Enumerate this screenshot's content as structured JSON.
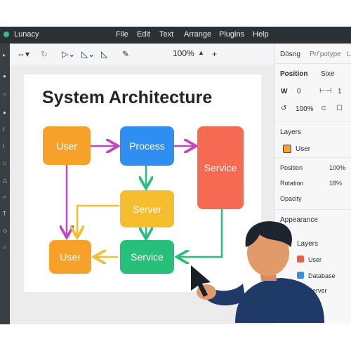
{
  "app": {
    "name": "Lunacy"
  },
  "menu": [
    "File",
    "Edit",
    "Text",
    "Arrange",
    "Plugins",
    "Help"
  ],
  "toolbar": {
    "zoom": "100%"
  },
  "canvas": {
    "title": "System Architecture",
    "nodes": {
      "user_top": "User",
      "process": "Process",
      "service_right": "Service",
      "server": "Server",
      "user_bottom": "User",
      "service_bottom": "Service"
    }
  },
  "panel": {
    "tabs": {
      "design": "Dösng",
      "prototype": "Pr/'potype",
      "extra": "L"
    },
    "position_label": "Position",
    "size_label": "Sixe",
    "w_label": "W",
    "w_value": "0",
    "h_value": "1",
    "opacity_value": "100%",
    "layers_label": "Layers",
    "selected_layer": "User",
    "props": {
      "position_label": "Position",
      "position_value": "100%",
      "rotation_label": "Rotation",
      "rotation_value": "18%",
      "opacity_label": "Opacity"
    },
    "appearance_label": "Appearance",
    "layers2_label": "Layers",
    "layer_items": [
      {
        "label": "User",
        "color": "#e8604c"
      },
      {
        "label": "Database",
        "color": "#3b8fe0"
      },
      {
        "label": "Server",
        "color": "#f2b630"
      }
    ]
  },
  "colors": {
    "orange": "#f7a12a",
    "blue": "#2f8ff0",
    "red": "#f56a52",
    "yellow": "#f6be2e",
    "green": "#26c07a",
    "magenta": "#c246c2"
  }
}
